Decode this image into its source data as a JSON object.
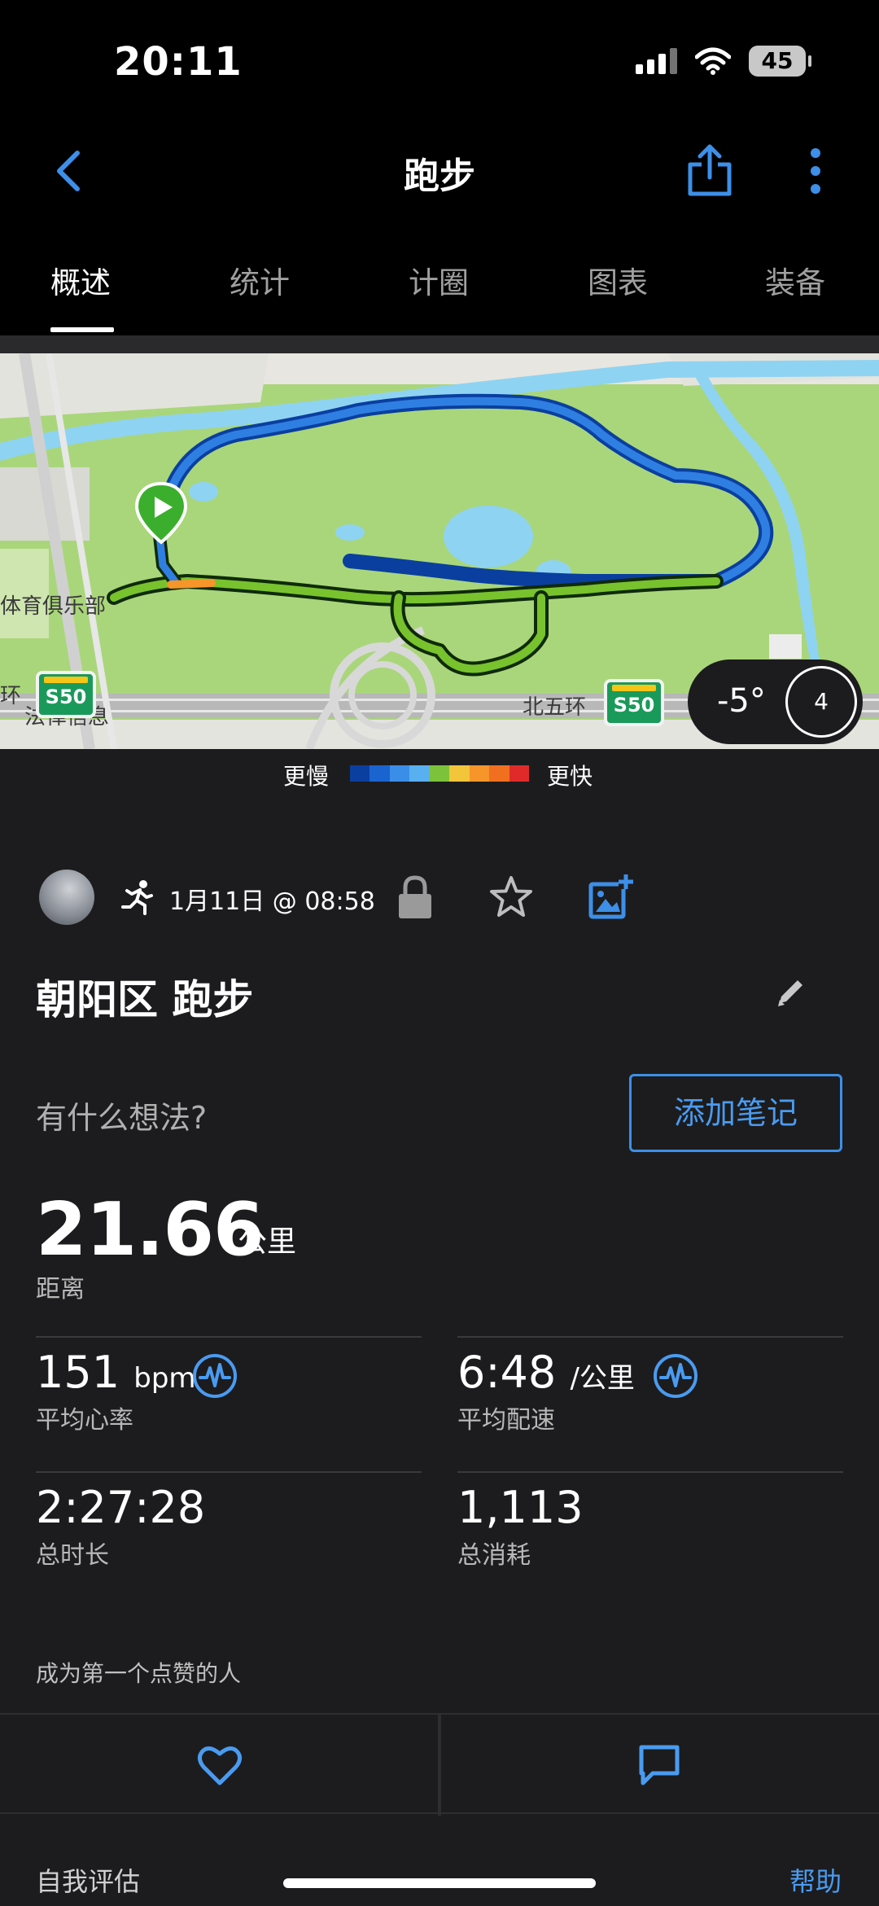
{
  "status_bar": {
    "time": "20:11",
    "battery": "45"
  },
  "nav": {
    "title": "跑步"
  },
  "tabs": [
    {
      "label": "概述",
      "active": true
    },
    {
      "label": "统计",
      "active": false
    },
    {
      "label": "计圈",
      "active": false
    },
    {
      "label": "图表",
      "active": false
    },
    {
      "label": "装备",
      "active": false
    }
  ],
  "map": {
    "labels": [
      "体育俱乐部",
      "北五环",
      "法律信息",
      "环"
    ],
    "road_shield": "S50",
    "weather_temp": "-5°",
    "wind_speed": "4"
  },
  "pace_legend": {
    "slow": "更慢",
    "fast": "更快",
    "colors": [
      "#0a3fa0",
      "#1a64d0",
      "#3a8ee8",
      "#58b0f0",
      "#7cc23a",
      "#f2c53a",
      "#f5952a",
      "#f07020",
      "#e02a2a"
    ]
  },
  "activity": {
    "datetime": "1月11日 @ 08:58",
    "title": "朝阳区 跑步",
    "thoughts_prompt": "有什么想法?",
    "add_note": "添加笔记"
  },
  "distance": {
    "value": "21.66",
    "unit": "公里",
    "label": "距离"
  },
  "stats": {
    "avg_hr": {
      "value": "151",
      "unit": "bpm",
      "label": "平均心率"
    },
    "avg_pace": {
      "value": "6:48",
      "unit": "/公里",
      "label": "平均配速"
    },
    "duration": {
      "value": "2:27:28",
      "label": "总时长"
    },
    "calories": {
      "value": "1,113",
      "label": "总消耗"
    }
  },
  "social": {
    "likes_text": "成为第一个点赞的人"
  },
  "footer": {
    "self_eval": "自我评估",
    "help": "帮助"
  },
  "colors": {
    "accent": "#4a9bf0",
    "background": "#1c1c1e"
  }
}
